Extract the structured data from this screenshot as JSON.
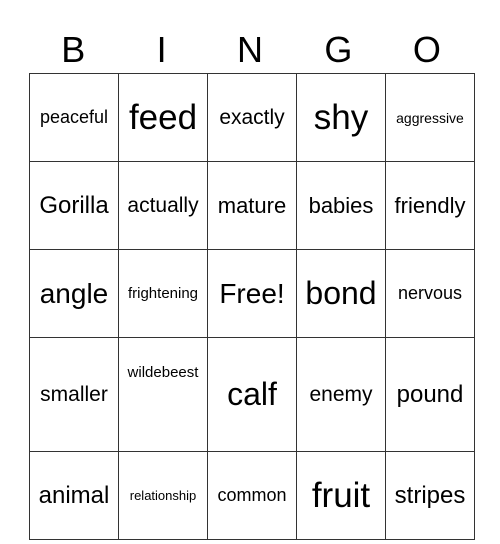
{
  "header": [
    "B",
    "I",
    "N",
    "G",
    "O"
  ],
  "grid": [
    [
      "peaceful",
      "feed",
      "exactly",
      "shy",
      "aggressive"
    ],
    [
      "Gorilla",
      "actually",
      "mature",
      "babies",
      "friendly"
    ],
    [
      "angle",
      "frightening",
      "Free!",
      "bond",
      "nervous"
    ],
    [
      "smaller",
      "wildebeest",
      "calf",
      "enemy",
      "pound"
    ],
    [
      "animal",
      "relationship",
      "common",
      "fruit",
      "stripes"
    ]
  ]
}
